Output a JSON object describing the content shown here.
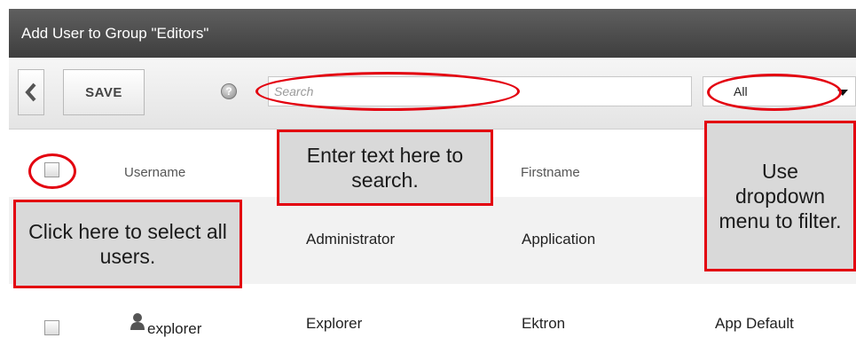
{
  "window": {
    "title": "Add User to Group \"Editors\""
  },
  "toolbar": {
    "save_label": "SAVE",
    "help_glyph": "?",
    "search_placeholder": "Search",
    "filter_selected": "All"
  },
  "table": {
    "columns": [
      "Username",
      "Firstname"
    ],
    "rows": [
      {
        "username": "",
        "lastname": "Administrator",
        "firstname": "Application",
        "extra": ""
      },
      {
        "username": "explorer",
        "lastname": "Explorer",
        "firstname": "Ektron",
        "extra": "App Default"
      }
    ]
  },
  "callouts": {
    "search": "Enter text here to search.",
    "dropdown": "Use dropdown menu to filter.",
    "select_all": "Click here to select all users."
  },
  "colors": {
    "titlebar": "#4a4a4a",
    "annotation_red": "#e3000f",
    "callout_fill": "#d9d9d9"
  }
}
